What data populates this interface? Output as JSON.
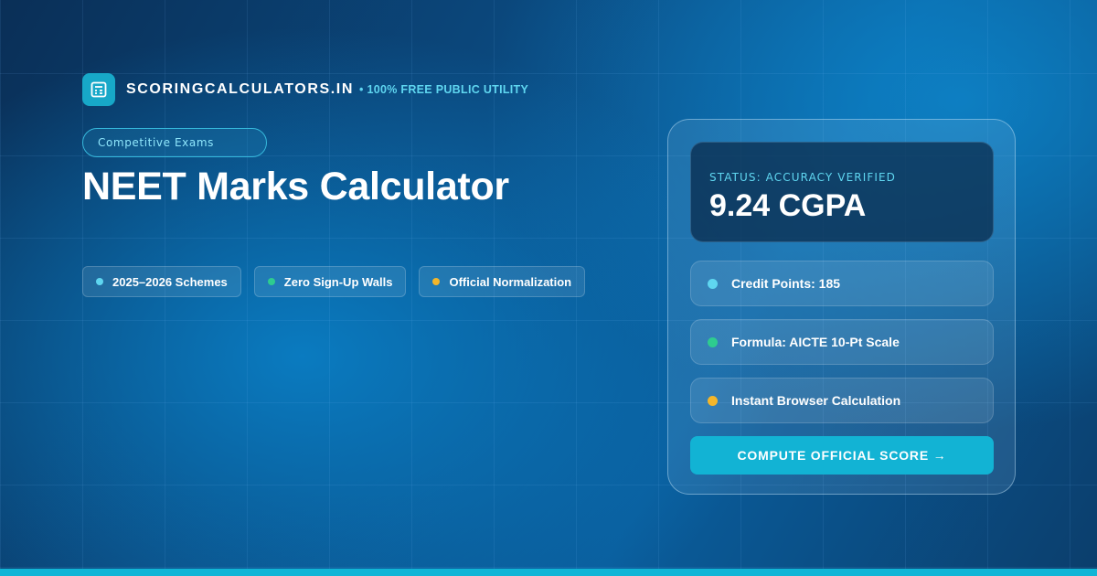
{
  "brand": {
    "name": "SCORINGCALCULATORS.IN",
    "tagline": "• 100% FREE PUBLIC UTILITY",
    "icon": "calculator-icon"
  },
  "category": "Competitive Exams",
  "title": "NEET Marks Calculator",
  "features": [
    {
      "label": "2025–2026 Schemes",
      "dot_color": "#5fd6f0"
    },
    {
      "label": "Zero Sign-Up Walls",
      "dot_color": "#2ecc8f"
    },
    {
      "label": "Official Normalization",
      "dot_color": "#f4b62a"
    }
  ],
  "card": {
    "status_label": "STATUS: ACCURACY VERIFIED",
    "status_value": "9.24 CGPA",
    "rows": [
      {
        "label": "Credit Points: 185",
        "dot_color": "#5fd6f0"
      },
      {
        "label": "Formula: AICTE 10-Pt Scale",
        "dot_color": "#2ecc8f"
      },
      {
        "label": "Instant Browser Calculation",
        "dot_color": "#f4b62a"
      }
    ],
    "button_label": "COMPUTE OFFICIAL SCORE →"
  },
  "colors": {
    "accent": "#12b3d4",
    "background": "#0b4a80"
  }
}
